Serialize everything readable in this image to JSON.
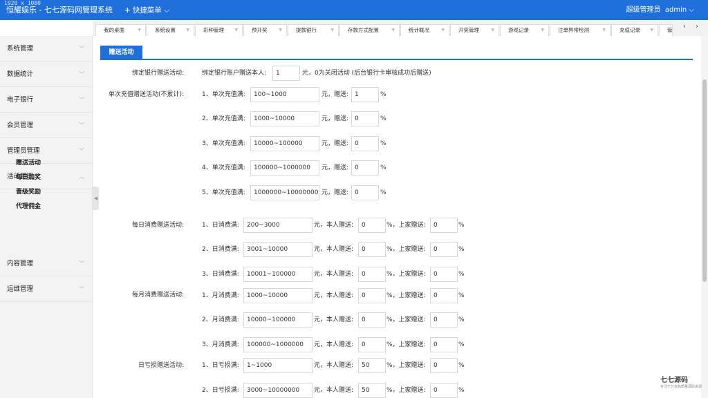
{
  "dims_overlay": "1920 x 1080",
  "header": {
    "title": "恒耀娱乐 - 七七源码网管理系统",
    "quick_menu": "快捷菜单",
    "role": "超级管理员",
    "user": "admin"
  },
  "tabs": [
    "我的桌面",
    "系统设置",
    "彩种管理",
    "预开奖",
    "提款银行",
    "存款方式配置",
    "统计概况",
    "开奖管理",
    "游戏记录",
    "注单异常检测",
    "充值记录",
    "管"
  ],
  "sidebar": {
    "items": [
      "系统管理",
      "数据统计",
      "电子银行",
      "会员管理",
      "管理员管理",
      "活动管理",
      "内容管理",
      "运维管理"
    ],
    "sub_items": [
      "赠送活动",
      "每日加奖",
      "晋级奖励",
      "代理佣金"
    ]
  },
  "panel": {
    "title": "赠送活动"
  },
  "bind_bank": {
    "label": "绑定银行赠送活动:",
    "prefix": "绑定银行账户赠送本人:",
    "value": "1",
    "suffix": "元，0为关闭活动 (后台银行卡审核成功后赠送)"
  },
  "single_recharge": {
    "label": "单次充值赠送活动(不累计):",
    "rows": [
      {
        "prefix": "1、单次充值满:",
        "range": "100~1000",
        "unit": "元，赠送:",
        "bonus": "1",
        "pct": "%"
      },
      {
        "prefix": "2、单次充值满:",
        "range": "1000~10000",
        "unit": "元，赠送:",
        "bonus": "0",
        "pct": "%"
      },
      {
        "prefix": "3、单次充值满:",
        "range": "10000~100000",
        "unit": "元，赠送:",
        "bonus": "0",
        "pct": "%"
      },
      {
        "prefix": "4、单次充值满:",
        "range": "100000~1000000",
        "unit": "元，赠送:",
        "bonus": "0",
        "pct": "%"
      },
      {
        "prefix": "5、单次充值满:",
        "range": "1000000~10000000",
        "unit": "元，赠送:",
        "bonus": "0",
        "pct": "%"
      }
    ]
  },
  "daily_consume": {
    "label": "每日消费赠送活动:",
    "rows": [
      {
        "prefix": "1、日消费满:",
        "range": "200~3000",
        "unit": "元，本人赠送:",
        "self": "0",
        "mid": "%，上家赠送:",
        "parent": "0",
        "pct": "%"
      },
      {
        "prefix": "2、日消费满:",
        "range": "3001~10000",
        "unit": "元，本人赠送:",
        "self": "0",
        "mid": "%，上家赠送:",
        "parent": "0",
        "pct": "%"
      },
      {
        "prefix": "3、日消费满:",
        "range": "10001~100000",
        "unit": "元，本人赠送:",
        "self": "0",
        "mid": "%，上家赠送:",
        "parent": "0",
        "pct": "%"
      }
    ]
  },
  "monthly_consume": {
    "label": "每月消费赠送活动:",
    "rows": [
      {
        "prefix": "1、月消费满:",
        "range": "1000~10000",
        "unit": "元，本人赠送:",
        "self": "0",
        "mid": "%，上家赠送:",
        "parent": "0",
        "pct": "%"
      },
      {
        "prefix": "2、月消费满:",
        "range": "10000~100000",
        "unit": "元，本人赠送:",
        "self": "0",
        "mid": "%，上家赠送:",
        "parent": "0",
        "pct": "%"
      },
      {
        "prefix": "3、月消费满:",
        "range": "100000~1000000",
        "unit": "元，本人赠送:",
        "self": "0",
        "mid": "%，上家赠送:",
        "parent": "0",
        "pct": "%"
      }
    ]
  },
  "daily_loss": {
    "label": "日亏损赠送活动:",
    "rows": [
      {
        "prefix": "1、日亏损满:",
        "range": "1~1000",
        "unit": "元，本人赠送:",
        "self": "50",
        "mid": "%，上家赠送:",
        "parent": "0",
        "pct": "%"
      },
      {
        "prefix": "2、日亏损满:",
        "range": "3000~10000000",
        "unit": "元，本人赠送:",
        "self": "50",
        "mid": "%，上家赠送:",
        "parent": "0",
        "pct": "%"
      }
    ]
  },
  "watermark": {
    "brand": "七七源码",
    "tagline": "专注于分享高质量源码资源"
  },
  "icons": {
    "chevron": "chevron-down-icon",
    "plus": "plus-icon",
    "collapse": "collapse-arrow-icon"
  },
  "colors": {
    "primary": "#1e6fd9",
    "sidebar_bg": "#f3f3f3"
  }
}
